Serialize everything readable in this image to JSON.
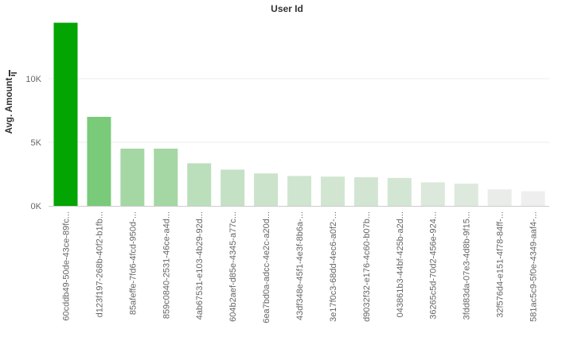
{
  "chart_data": {
    "type": "bar",
    "title": "User Id",
    "xlabel": "",
    "ylabel": "Avg. Amount",
    "ylim": [
      0,
      15000
    ],
    "yticks": [
      0,
      5000,
      10000
    ],
    "ytick_labels": [
      "0K",
      "5K",
      "10K"
    ],
    "grid": true,
    "categories": [
      "60cddb49-50de-43ce-89fc...",
      "d123f197-268b-40f2-b1fb...",
      "85afeffe-7fd6-4fcd-950d-...",
      "859c0840-2531-46ce-a4d...",
      "4ab67531-e103-4b29-92d...",
      "604b2aef-d85e-4345-a77c...",
      "6ea7bd0a-adcc-4e2c-a20d...",
      "43df348e-45f1-4e3f-8b6a-...",
      "3e17f0c3-68dd-4ec6-a0f2-...",
      "d9032f32-e176-4c60-b07b...",
      "043861b3-44bf-425b-a2d...",
      "36265c5d-70d2-456e-924...",
      "3fdd83da-07e3-4d8b-9f15...",
      "32f576d4-e151-4f78-84ff-...",
      "581ac5c9-5f0e-4349-aaf4-..."
    ],
    "values": [
      14400,
      7000,
      4500,
      4500,
      3350,
      2850,
      2550,
      2350,
      2300,
      2250,
      2200,
      1850,
      1750,
      1300,
      1150
    ],
    "color_scale": {
      "low": "#eeeeee",
      "high": "#03a503"
    }
  },
  "sort_icon": "sort-descending-icon"
}
